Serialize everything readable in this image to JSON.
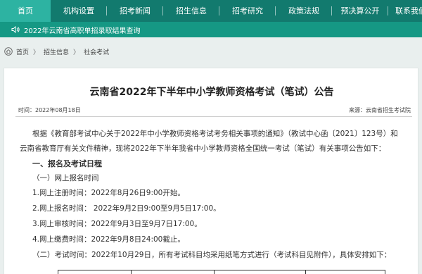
{
  "nav": {
    "items": [
      {
        "label": "首页",
        "active": true
      },
      {
        "label": "机构设置"
      },
      {
        "label": "招考新闻"
      },
      {
        "label": "招生信息"
      },
      {
        "label": "招考研究"
      },
      {
        "label": "政策法规"
      },
      {
        "label": "预决算公开"
      },
      {
        "label": "联系我们"
      }
    ]
  },
  "notice": {
    "icon": "speaker-icon",
    "text": "2022年云南省高职单招录取结果查询"
  },
  "breadcrumb": {
    "icon": "home-icon",
    "items": [
      "首页",
      "招生信息",
      "社会考试"
    ],
    "separator": "〉"
  },
  "article": {
    "title": "云南省2022年下半年中小学教师资格考试（笔试）公告",
    "time_label": "时间：2022年08月18日",
    "source_label": "来源：云南省招生考试院",
    "paragraphs": [
      "根据《教育部考试中心关于2022年中小学教师资格考试考务相关事项的通知》（教试中心函〔2021〕123号）和",
      "云南省教育厅有关文件精神，现将2022年下半年我省中小学教师资格全国统一考试（笔试）有关事项公告如下：",
      "一、报名及考试日程",
      "（一）网上报名时间",
      "1.网上注册时间：2022年8月26日9:00开始。",
      "2.网上报名时间：  2022年9月2日9:00至9月5日17:00。",
      "3.网上审核时间：2022年9月3日至9月7日17:00。",
      "4.网上缴费时间：2022年9月8日24:00截止。",
      "（二）考试时间：2022年10月29日，所有考试科目均采用纸笔方式进行（考试科目见附件），具体安排如下："
    ]
  },
  "colors": {
    "nav_bg": "#127a6e",
    "nav_active": "#2db3a2",
    "notice_bg": "#159884",
    "page_bg": "#e9efee"
  }
}
